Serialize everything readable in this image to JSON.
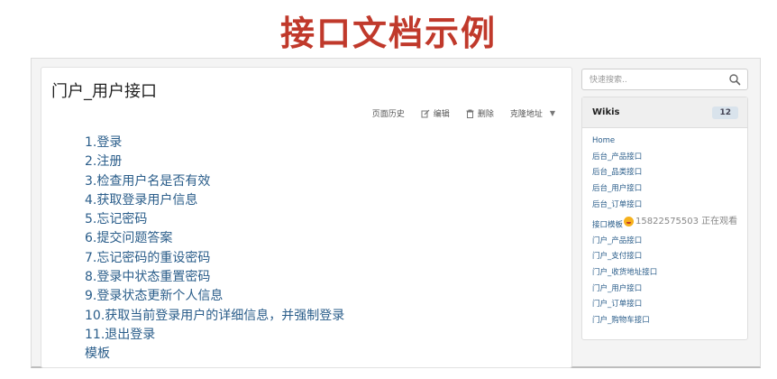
{
  "colors": {
    "title": "#c0392b",
    "link": "#2a5d8a"
  },
  "slide": {
    "title": "接口文档示例"
  },
  "page": {
    "title": "门户_用户接口"
  },
  "actions": {
    "history": {
      "label": "页面历史"
    },
    "edit": {
      "label": "编辑",
      "icon": "pencil-icon"
    },
    "delete": {
      "label": "删除",
      "icon": "trash-icon"
    },
    "clone": {
      "label": "克隆地址",
      "icon": "caret-down-icon"
    }
  },
  "toc": [
    "1.登录",
    "2.注册",
    "3.检查用户名是否有效",
    "4.获取登录用户信息",
    "5.忘记密码",
    "6.提交问题答案",
    "7.忘记密码的重设密码",
    "8.登录中状态重置密码",
    "9.登录状态更新个人信息",
    "10.获取当前登录用户的详细信息，并强制登录",
    "11.退出登录",
    "模板"
  ],
  "search": {
    "placeholder": "快速搜索..",
    "value": "",
    "icon": "search-icon"
  },
  "wikis": {
    "title": "Wikis",
    "count": "12",
    "items": [
      "Home",
      "后台_产品接口",
      "后台_品类接口",
      "后台_用户接口",
      "后台_订单接口",
      "接口模板",
      "门户_产品接口",
      "门户_支付接口",
      "门户_收货地址接口",
      "门户_用户接口",
      "门户_订单接口",
      "门户_购物车接口"
    ],
    "viewer_overlay": "15822575503 正在观看"
  }
}
